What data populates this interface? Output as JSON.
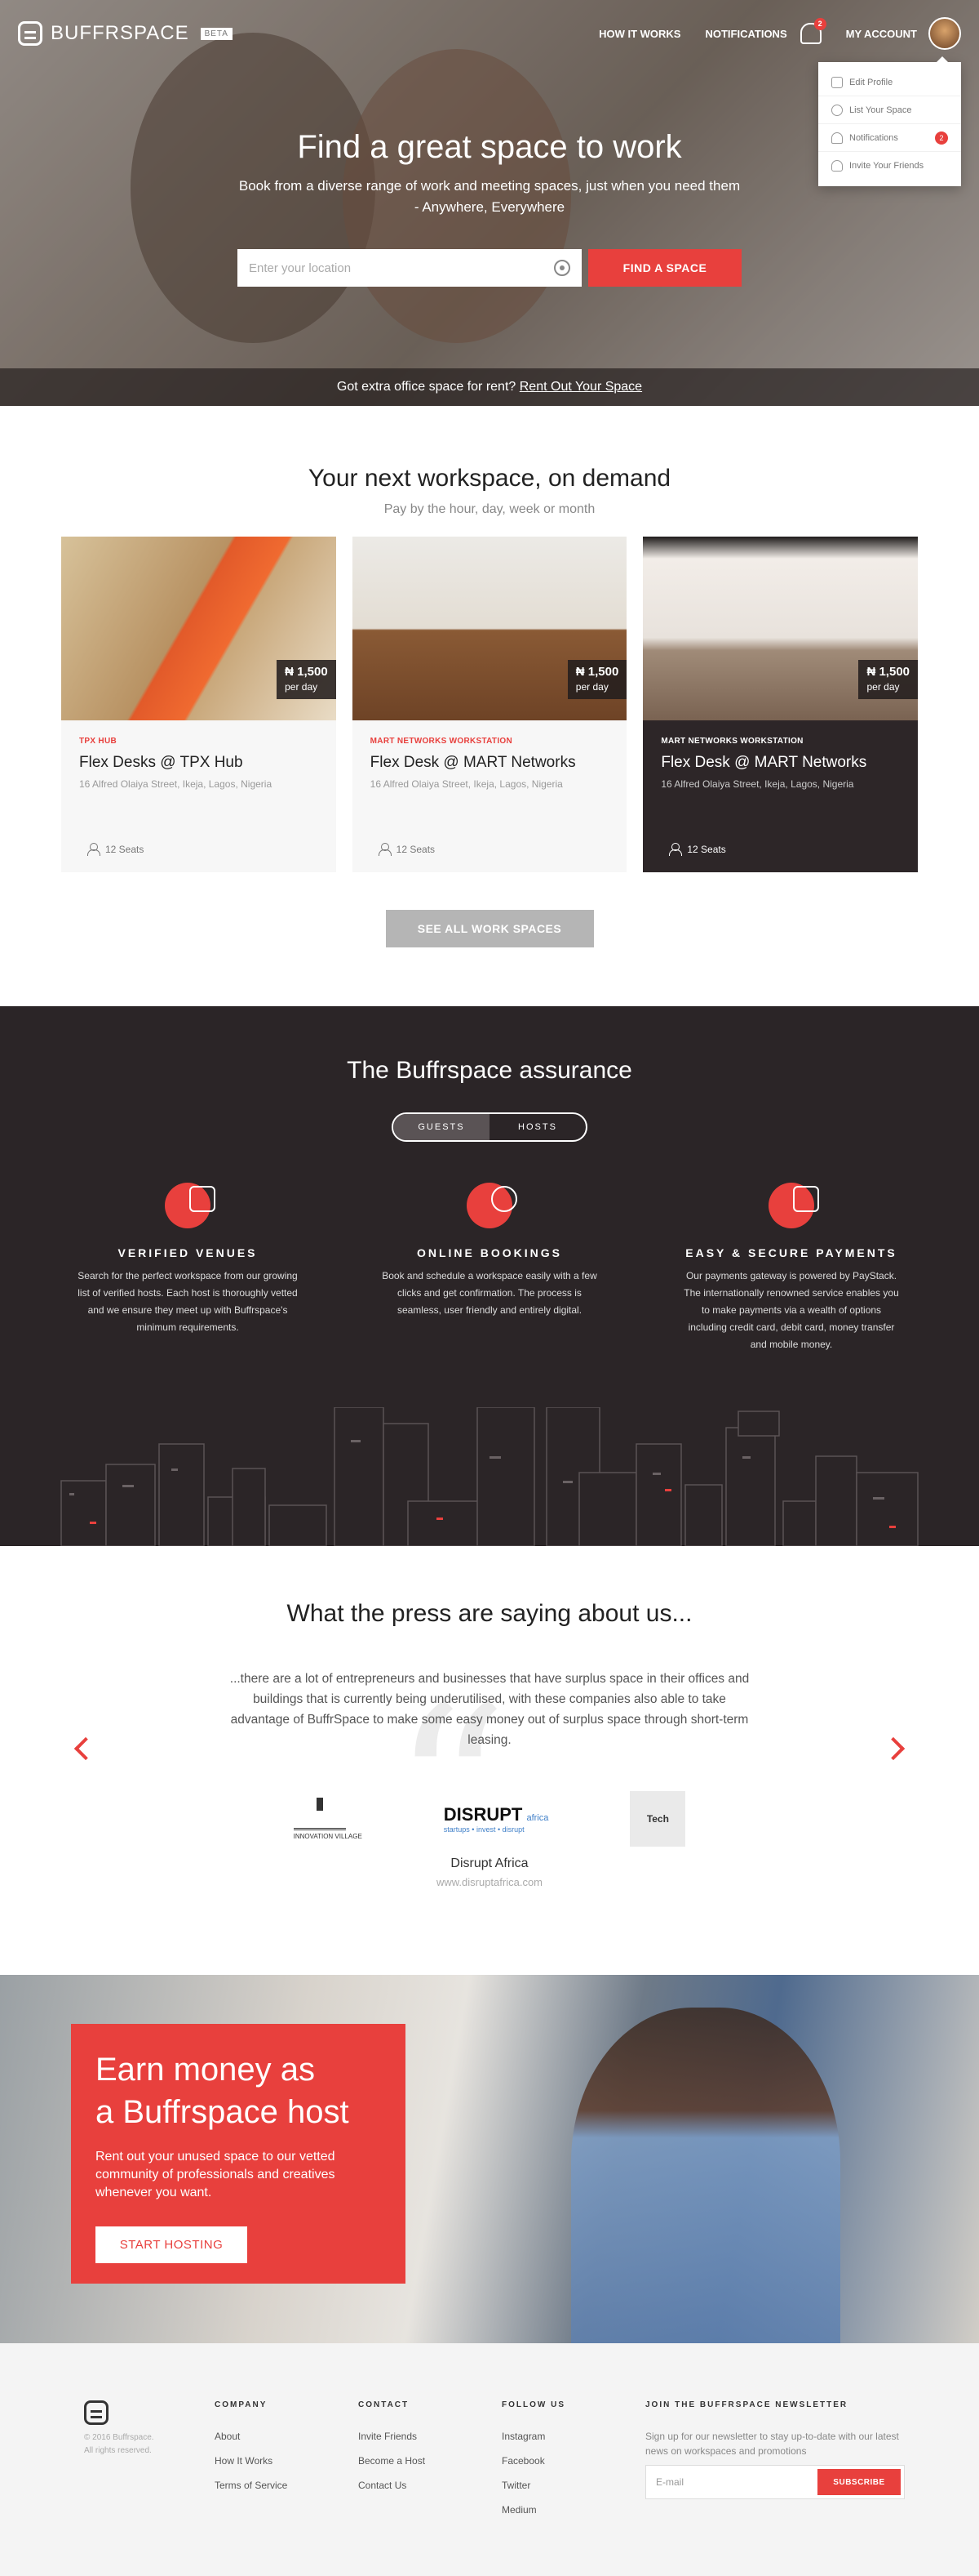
{
  "header": {
    "brand": "BUFFRSPACE",
    "beta": "BETA",
    "nav": {
      "how_it_works": "HOW IT WORKS",
      "notifications": "NOTIFICATIONS",
      "notifications_count": "2",
      "my_account": "MY ACCOUNT"
    },
    "account_menu": [
      {
        "label": "Edit Profile",
        "icon": "edit-icon"
      },
      {
        "label": "List Your Space",
        "icon": "plus-icon"
      },
      {
        "label": "Notifications",
        "icon": "bell-icon",
        "badge": "2"
      },
      {
        "label": "Invite Your Friends",
        "icon": "invite-icon"
      }
    ]
  },
  "hero": {
    "title": "Find a great space to work",
    "subtitle": "Book from a diverse range of work and meeting spaces, just when you need them - Anywhere, Everywhere",
    "search_placeholder": "Enter your location",
    "search_button": "FIND A SPACE",
    "rent_text": "Got extra office space for rent?",
    "rent_link": "Rent Out Your Space"
  },
  "ondemand": {
    "title": "Your next workspace, on demand",
    "subtitle": "Pay by the hour, day, week or month",
    "cards": [
      {
        "price": "₦ 1,500",
        "period": "per day",
        "tag": "TPX HUB",
        "name": "Flex Desks @ TPX Hub",
        "address": "16 Alfred Olaiya Street, Ikeja, Lagos, Nigeria",
        "seats": "12 Seats"
      },
      {
        "price": "₦ 1,500",
        "period": "per day",
        "tag": "MART NETWORKS WORKSTATION",
        "name": "Flex Desk @ MART Networks",
        "address": "16 Alfred Olaiya Street, Ikeja, Lagos, Nigeria",
        "seats": "12 Seats"
      },
      {
        "price": "₦ 1,500",
        "period": "per day",
        "tag": "MART NETWORKS WORKSTATION",
        "name": "Flex Desk @ MART Networks",
        "address": "16 Alfred Olaiya Street, Ikeja, Lagos, Nigeria",
        "seats": "12 Seats"
      }
    ],
    "see_all": "SEE ALL WORK SPACES"
  },
  "assurance": {
    "title": "The Buffrspace assurance",
    "tabs": [
      "GUESTS",
      "HOSTS"
    ],
    "features": [
      {
        "icon": "thumbs-up-icon",
        "title": "VERIFIED VENUES",
        "text": "Search for the perfect workspace from our growing list of verified hosts. Each host is thoroughly vetted and we ensure they meet up with Buffrspace's minimum requirements."
      },
      {
        "icon": "globe-icon",
        "title": "ONLINE BOOKINGS",
        "text": "Book and schedule a workspace easily with a few clicks and get confirmation. The process is seamless, user friendly and entirely digital."
      },
      {
        "icon": "wallet-icon",
        "title": "EASY & SECURE PAYMENTS",
        "text": "Our payments gateway is powered by PayStack. The internationally renowned service enables you to make payments via a wealth of options including credit card, debit card, money transfer and mobile money."
      }
    ]
  },
  "press": {
    "title": "What the press are saying about us...",
    "quote": "...there are a lot of entrepreneurs and businesses that have surplus space in their offices and buildings that is currently being underutilised, with these companies also able to take advantage of BuffrSpace to make some easy money out of surplus space through short-term leasing.",
    "logos": {
      "innovation": "INNOVATION VILLAGE",
      "disrupt": "DISRUPT",
      "disrupt_tag": "africa",
      "disrupt_tagline": "startups • invest • disrupt",
      "tech": "Tech"
    },
    "source_name": "Disrupt Africa",
    "source_url": "www.disruptafrica.com"
  },
  "host": {
    "title_line1": "Earn money as",
    "title_line2": "a Buffrspace host",
    "text": "Rent out your unused space to our vetted community of professionals and creatives whenever you want.",
    "button": "START HOSTING"
  },
  "footer": {
    "copyright_1": "© 2016 Buffrspace.",
    "copyright_2": "All rights reserved.",
    "company": {
      "title": "COMPANY",
      "links": [
        "About",
        "How It Works",
        "Terms of Service"
      ]
    },
    "contact": {
      "title": "CONTACT",
      "links": [
        "Invite Friends",
        "Become a Host",
        "Contact Us"
      ]
    },
    "follow": {
      "title": "FOLLOW US",
      "links": [
        "Instagram",
        "Facebook",
        "Twitter",
        "Medium"
      ]
    },
    "newsletter": {
      "title": "JOIN THE BUFFRSPACE NEWSLETTER",
      "text": "Sign up for our newsletter to stay up-to-date with our latest news on workspaces and promotions",
      "placeholder": "E-mail",
      "button": "SUBSCRIBE"
    }
  },
  "colors": {
    "accent": "#e8403d",
    "dark": "#2b2527",
    "footer_bg": "#f4f4f4"
  }
}
